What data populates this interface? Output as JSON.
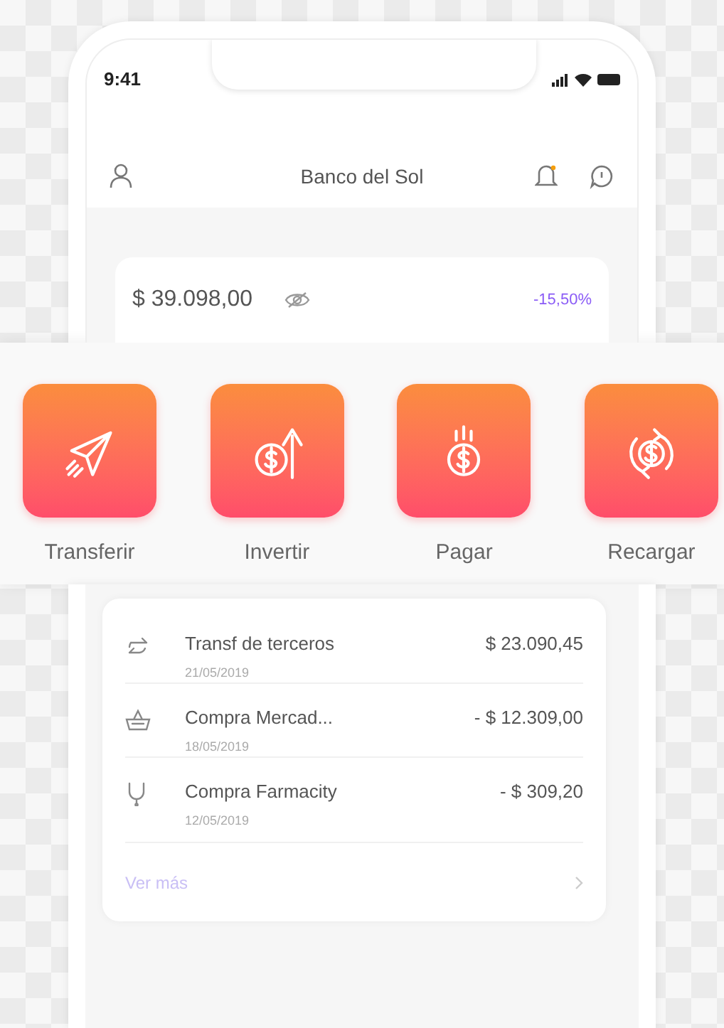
{
  "status_bar": {
    "time": "9:41"
  },
  "header": {
    "title": "Banco del Sol"
  },
  "balance": {
    "amount": "$ 39.098,00",
    "change": "-15,50%"
  },
  "actions": [
    {
      "label": "Transferir",
      "kind": "send"
    },
    {
      "label": "Invertir",
      "kind": "invest"
    },
    {
      "label": "Pagar",
      "kind": "pay"
    },
    {
      "label": "Recargar",
      "kind": "recharge"
    }
  ],
  "transactions": [
    {
      "kind": "transfer",
      "title": "Transf de terceros",
      "date": "21/05/2019",
      "amount": "$ 23.090,45"
    },
    {
      "kind": "basket",
      "title": "Compra Mercad...",
      "date": "18/05/2019",
      "amount": "- $ 12.309,00"
    },
    {
      "kind": "stethoscope",
      "title": "Compra Farmacity",
      "date": "12/05/2019",
      "amount": "- $ 309,20"
    }
  ],
  "more_link": {
    "label": "Ver más"
  }
}
